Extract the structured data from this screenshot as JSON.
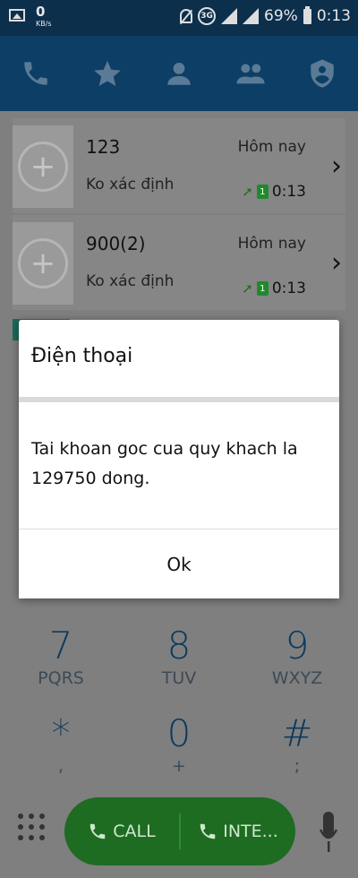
{
  "status_bar": {
    "net_speed_value": "0",
    "net_speed_unit": "KB/s",
    "network_type": "3G",
    "battery_percent": "69%",
    "clock": "0:13"
  },
  "tabs": [
    {
      "icon": "phone-icon"
    },
    {
      "icon": "star-icon"
    },
    {
      "icon": "person-icon"
    },
    {
      "icon": "group-icon"
    },
    {
      "icon": "shield-person-icon"
    }
  ],
  "call_log": [
    {
      "name": "123",
      "subtitle": "Ko xác định",
      "date": "Hôm nay",
      "time": "0:13",
      "sim": "1"
    },
    {
      "name": "900(2)",
      "subtitle": "Ko xác định",
      "date": "Hôm nay",
      "time": "0:13",
      "sim": "1"
    }
  ],
  "dialpad": {
    "rows": [
      [
        {
          "digit": "7",
          "letters": "PQRS"
        },
        {
          "digit": "8",
          "letters": "TUV"
        },
        {
          "digit": "9",
          "letters": "WXYZ"
        }
      ],
      [
        {
          "digit": "*",
          "letters": ","
        },
        {
          "digit": "0",
          "letters": "+"
        },
        {
          "digit": "#",
          "letters": ";"
        }
      ]
    ],
    "call_label": "CALL",
    "internet_call_label": "INTE..."
  },
  "dialog": {
    "title": "Điện thoại",
    "message": "Tai khoan goc cua quy khach la 129750 dong.",
    "ok_label": "Ok"
  }
}
